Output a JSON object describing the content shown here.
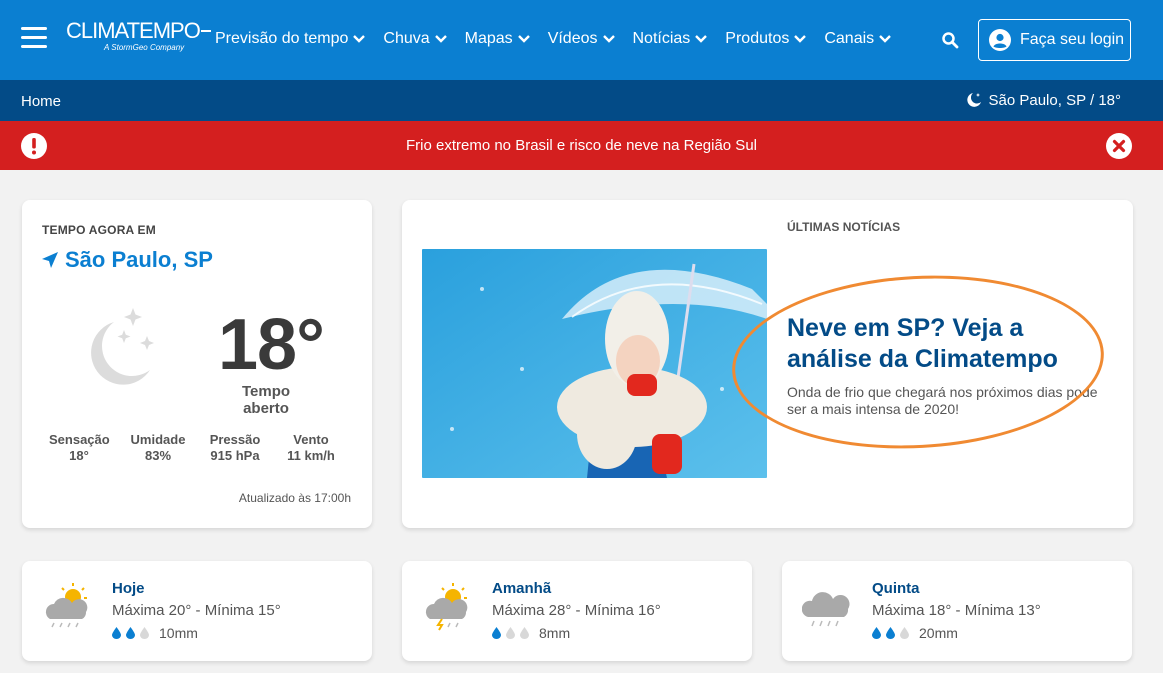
{
  "header": {
    "logo_name": "CLIMATEMPO",
    "logo_sub": "A StormGeo Company",
    "nav": [
      "Previsão do tempo",
      "Chuva",
      "Mapas",
      "Vídeos",
      "Notícias",
      "Produtos",
      "Canais"
    ],
    "login_label": "Faça seu login"
  },
  "breadcrumb": {
    "home": "Home",
    "current_location": "São Paulo, SP / 18°"
  },
  "alert": {
    "message": "Frio extremo no Brasil e risco de neve na Região Sul"
  },
  "now": {
    "label": "TEMPO AGORA EM",
    "city": "São Paulo, SP",
    "temperature": "18°",
    "condition": "Tempo aberto",
    "stats": [
      {
        "label": "Sensação",
        "value": "18°"
      },
      {
        "label": "Umidade",
        "value": "83%"
      },
      {
        "label": "Pressão",
        "value": "915 hPa"
      },
      {
        "label": "Vento",
        "value": "11 km/h"
      }
    ],
    "updated": "Atualizado às 17:00h"
  },
  "news": {
    "label": "ÚLTIMAS NOTÍCIAS",
    "title": "Neve em SP? Veja a análise da Climatempo",
    "description": "Onda de frio que chegará nos próximos dias pode ser a mais intensa de 2020!"
  },
  "forecast": [
    {
      "day": "Hoje",
      "range": "Máxima 20° - Mínima 15°",
      "rain": "10mm",
      "drops_filled": 2,
      "icon": "sun-cloud-rain-icon"
    },
    {
      "day": "Amanhã",
      "range": "Máxima 28° - Mínima 16°",
      "rain": "8mm",
      "drops_filled": 1,
      "icon": "sun-cloud-storm-icon"
    },
    {
      "day": "Quinta",
      "range": "Máxima 18° - Mínima 13°",
      "rain": "20mm",
      "drops_filled": 2,
      "icon": "cloud-rain-icon"
    }
  ],
  "colors": {
    "header_blue": "#0b7fd1",
    "dark_blue": "#034b87",
    "alert_red": "#d41f1f",
    "highlight_orange": "#f08a32"
  }
}
